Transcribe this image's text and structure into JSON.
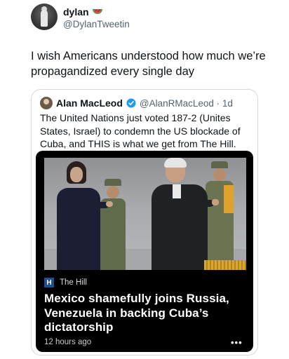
{
  "tweet": {
    "display_name": "dylan",
    "handle": "@DylanTweetin",
    "text": "I wish Americans understood how much we’re propagandized every single day",
    "avatar_icon": "profile-photo",
    "name_emoji": "watermelon-icon"
  },
  "quote": {
    "display_name": "Alan MacLeod",
    "handle_time": "@AlanRMacLeod · 1d",
    "verified_icon": "verified-badge-icon",
    "text": "The United Nations just voted 187-2 (Unites States, Israel) to condemn the US blockade of Cuba, and THIS is what we get from The Hill.",
    "card": {
      "source_logo": "H",
      "source_name": "The Hill",
      "headline": "Mexico shamefully joins Russia, Venezuela in backing Cuba’s dictatorship",
      "time": "12 hours ago",
      "more": "•••",
      "background": "#000000"
    }
  },
  "colors": {
    "text": "#0f1419",
    "secondary": "#536471",
    "verified": "#1d9bf0",
    "border": "#cfd9de"
  }
}
